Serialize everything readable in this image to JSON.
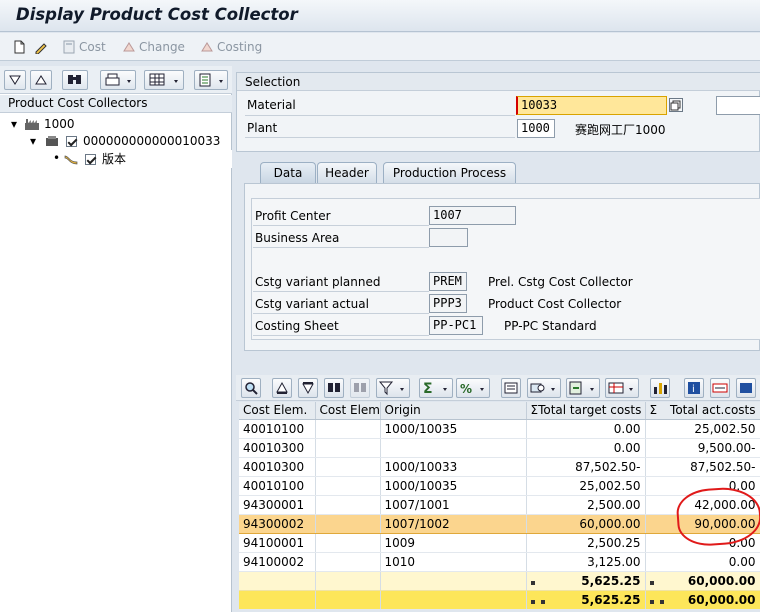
{
  "window": {
    "title": "Display Product Cost Collector"
  },
  "toolbar": {
    "cost_label": "Cost",
    "change_label": "Change",
    "costing_label": "Costing"
  },
  "tree": {
    "header": "Product Cost Collectors",
    "nodes": [
      {
        "label": "1000"
      },
      {
        "label": "000000000000010033"
      },
      {
        "label": "版本"
      }
    ]
  },
  "selection": {
    "title": "Selection",
    "material_label": "Material",
    "material_value": "10033",
    "plant_label": "Plant",
    "plant_value": "1000",
    "plant_desc": "赛跑网工厂1000"
  },
  "tabs": [
    {
      "label": "Data"
    },
    {
      "label": "Header"
    },
    {
      "label": "Production Process"
    }
  ],
  "data_tab": {
    "profit_center_label": "Profit Center",
    "profit_center_value": "1007",
    "business_area_label": "Business Area",
    "business_area_value": "",
    "cv_planned_label": "Cstg variant planned",
    "cv_planned_value": "PREM",
    "cv_planned_desc": "Prel. Cstg Cost Collector",
    "cv_actual_label": "Cstg variant actual",
    "cv_actual_value": "PPP3",
    "cv_actual_desc": "Product Cost Collector",
    "costing_sheet_label": "Costing Sheet",
    "costing_sheet_value": "PP-PC1",
    "costing_sheet_desc": "PP-PC Standard"
  },
  "grid": {
    "columns": [
      "Cost Elem.",
      "Cost Elem.",
      "Origin",
      "Total target costs",
      "Total act.costs"
    ],
    "rows": [
      [
        "40010100",
        "",
        "1000/10035",
        "0.00",
        "25,002.50"
      ],
      [
        "40010300",
        "",
        "",
        "0.00",
        "9,500.00-"
      ],
      [
        "40010300",
        "",
        "1000/10033",
        "87,502.50-",
        "87,502.50-"
      ],
      [
        "40010100",
        "",
        "1000/10035",
        "25,002.50",
        "0.00"
      ],
      [
        "94300001",
        "",
        "1007/1001",
        "2,500.00",
        "42,000.00"
      ],
      [
        "94300002",
        "",
        "1007/1002",
        "60,000.00",
        "90,000.00"
      ],
      [
        "94100001",
        "",
        "1009",
        "2,500.25",
        "0.00"
      ],
      [
        "94100002",
        "",
        "1010",
        "3,125.00",
        "0.00"
      ]
    ],
    "subtotal": [
      "5,625.25",
      "60,000.00"
    ],
    "total": [
      "5,625.25",
      "60,000.00"
    ]
  },
  "colors": {
    "selected_row": "#fbd58e",
    "total_row": "#fde65a",
    "annotation": "#e01a1a"
  }
}
